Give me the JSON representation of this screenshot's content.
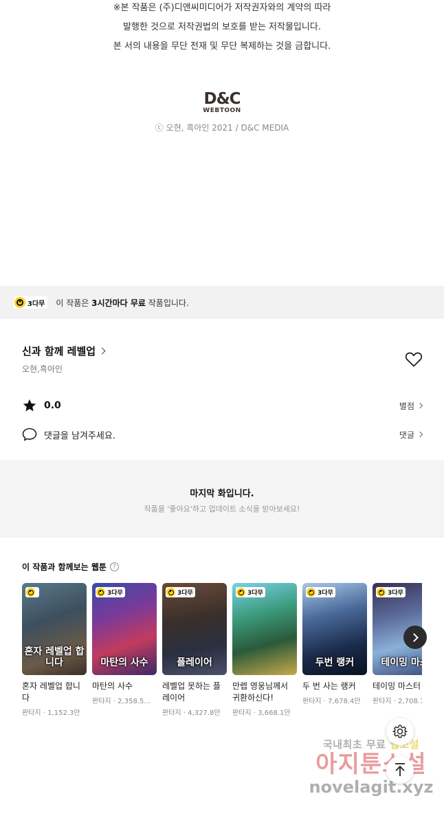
{
  "copyright_notice": {
    "lines": [
      "※본 작품은 (주)디앤씨미디어가 저작권자와의 계약의 따라",
      "발행한 것으로 저작권법의 보호를 받는 저작물입니다.",
      "본 서의 내용을 무단 전재 및 무단 복제하는 것을 금합니다."
    ]
  },
  "publisher": {
    "logo_main": "D&C",
    "logo_sub": "WEBTOON",
    "credit": "ⓒ 오현, 흑아인 2021 / D&C MEDIA"
  },
  "free_bar": {
    "badge": "3다무",
    "text_pre": "이 작품은 ",
    "text_bold": "3시간마다 무료",
    "text_post": " 작품입니다."
  },
  "work": {
    "title": "신과 함께 레벨업",
    "authors": "오현,흑아인",
    "rating": "0.0",
    "rating_link": "별점",
    "comment_placeholder": "댓글을 남겨주세요.",
    "comment_link": "댓글"
  },
  "last_episode": {
    "title": "마지막 화입니다.",
    "subtitle": "작품을 '좋아요'하고 업데이트 소식을 받아보세요!"
  },
  "recommendations": {
    "title": "이 작품과 함께보는 웹툰",
    "help": "?",
    "items": [
      {
        "name": "혼자 레벨업 합니다",
        "genre": "판타지",
        "views": "1,152.3만",
        "badge": "",
        "cover_text": "혼자 레벨업 합니다"
      },
      {
        "name": "마탄의 사수",
        "genre": "판타지",
        "views": "2,358.5...",
        "badge": "3다무",
        "cover_text": "마탄의 사수"
      },
      {
        "name": "레벨업 못하는 플레이어",
        "genre": "판타지",
        "views": "4,327.8만",
        "badge": "3다무",
        "cover_text": "플레이어"
      },
      {
        "name": "만렙 영웅님께서 귀환하신다!",
        "genre": "판타지",
        "views": "3,668.1만",
        "badge": "3다무",
        "cover_text": ""
      },
      {
        "name": "두 번 사는 랭커",
        "genre": "판타지",
        "views": "7,678.4만",
        "badge": "3다무",
        "cover_text": "두번 랭커"
      },
      {
        "name": "테이밍 마스터",
        "genre": "판타지",
        "views": "2,708.7",
        "badge": "3다무",
        "cover_text": "테이밍 마스"
      }
    ],
    "separator": "·"
  },
  "watermark": {
    "line1a": "국내최초 무료 ",
    "line1b": "웹소설",
    "line2": "아지툰소설",
    "line3": "novelagit.xyz"
  },
  "colors": {
    "badge_yellow": "#ffd21f",
    "free_bar_bg": "#f2f2f2",
    "last_ep_bg": "#f5f5f5"
  }
}
